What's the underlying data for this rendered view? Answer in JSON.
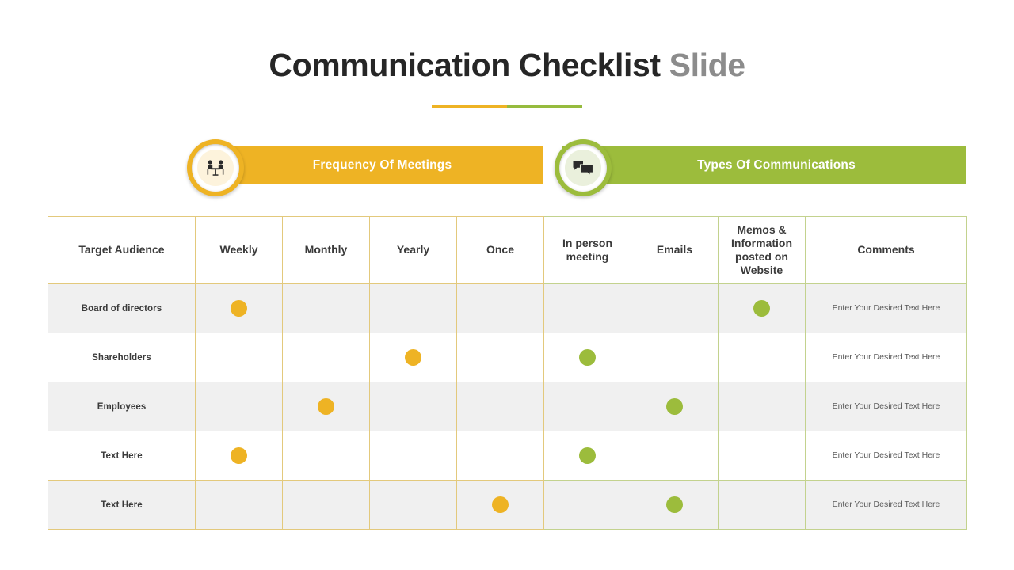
{
  "slide": {
    "title_main": "Communication Checklist",
    "title_sub": "Slide"
  },
  "banners": [
    {
      "label": "Frequency Of Meetings",
      "color": "#eeb324",
      "icon": "meeting-table-icon"
    },
    {
      "label": "Types Of Communications",
      "color": "#9cbc3c",
      "icon": "speech-bubbles-icon"
    }
  ],
  "table": {
    "headers": [
      "Target Audience",
      "Weekly",
      "Monthly",
      "Yearly",
      "Once",
      "In person meeting",
      "Emails",
      "Memos & Information posted on Website",
      "Comments"
    ],
    "rows": [
      {
        "audience": "Board of directors",
        "weekly": "yellow",
        "monthly": "none",
        "yearly": "none",
        "once": "none",
        "in_person_meeting": "none",
        "emails": "none",
        "memos_website": "green",
        "comments": "Enter Your Desired Text Here"
      },
      {
        "audience": "Shareholders",
        "weekly": "none",
        "monthly": "none",
        "yearly": "yellow",
        "once": "none",
        "in_person_meeting": "green",
        "emails": "none",
        "memos_website": "none",
        "comments": "Enter Your Desired Text Here"
      },
      {
        "audience": "Employees",
        "weekly": "none",
        "monthly": "yellow",
        "yearly": "none",
        "once": "none",
        "in_person_meeting": "none",
        "emails": "green",
        "memos_website": "none",
        "comments": "Enter Your Desired Text Here"
      },
      {
        "audience": "Text Here",
        "weekly": "yellow",
        "monthly": "none",
        "yearly": "none",
        "once": "none",
        "in_person_meeting": "green",
        "emails": "none",
        "memos_website": "none",
        "comments": "Enter Your Desired Text Here"
      },
      {
        "audience": "Text Here",
        "weekly": "none",
        "monthly": "none",
        "yearly": "none",
        "once": "yellow",
        "in_person_meeting": "none",
        "emails": "green",
        "memos_website": "none",
        "comments": "Enter Your Desired Text Here"
      }
    ]
  },
  "colors": {
    "yellow": "#eeb324",
    "green": "#9cbc3c",
    "yellow_border": "#e3c97c",
    "green_border": "#c3d28e",
    "row_alt": "#f0f0f0",
    "title_main": "#262626",
    "title_sub": "#8c8c8c"
  }
}
